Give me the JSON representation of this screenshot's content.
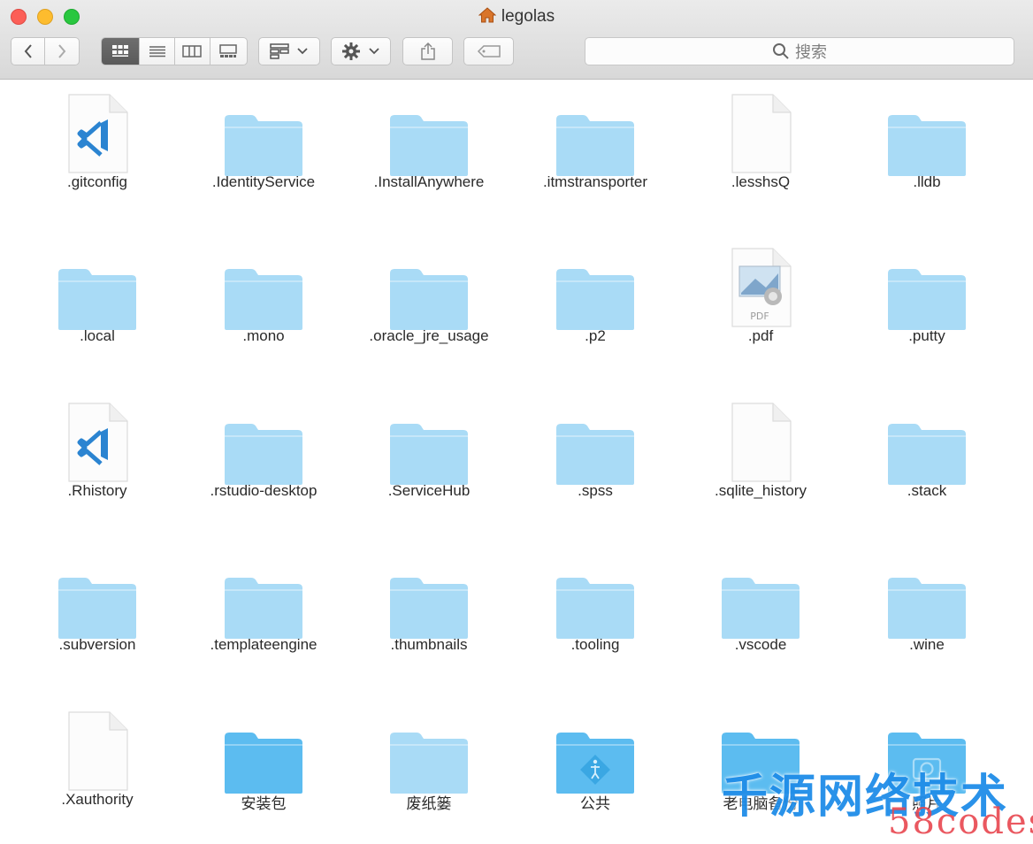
{
  "window": {
    "title": "legolas",
    "title_icon": "home-icon"
  },
  "toolbar": {
    "back": "chevron-left-icon",
    "forward": "chevron-right-icon",
    "views": [
      "icon-view-icon",
      "list-view-icon",
      "column-view-icon",
      "gallery-view-icon"
    ],
    "active_view": 0,
    "arrange": "group-icon",
    "action": "gear-icon",
    "share": "share-icon",
    "tags": "tag-icon"
  },
  "search": {
    "placeholder": "搜索",
    "icon": "search-icon"
  },
  "colors": {
    "folder": "#a9dbf6",
    "folder_dark": "#5cbcf0",
    "vscode": "#2b84d1"
  },
  "items": [
    {
      "label": ".gitconfig",
      "icon": "vscode-doc"
    },
    {
      "label": ".IdentityService",
      "icon": "folder"
    },
    {
      "label": ".InstallAnywhere",
      "icon": "folder"
    },
    {
      "label": ".itmstransporter",
      "icon": "folder"
    },
    {
      "label": ".lesshsQ",
      "icon": "doc"
    },
    {
      "label": ".lldb",
      "icon": "folder"
    },
    {
      "label": ".local",
      "icon": "folder"
    },
    {
      "label": ".mono",
      "icon": "folder"
    },
    {
      "label": ".oracle_jre_usage",
      "icon": "folder"
    },
    {
      "label": ".p2",
      "icon": "folder"
    },
    {
      "label": ".pdf",
      "icon": "pdf-doc"
    },
    {
      "label": ".putty",
      "icon": "folder"
    },
    {
      "label": ".Rhistory",
      "icon": "vscode-doc"
    },
    {
      "label": ".rstudio-desktop",
      "icon": "folder"
    },
    {
      "label": ".ServiceHub",
      "icon": "folder"
    },
    {
      "label": ".spss",
      "icon": "folder"
    },
    {
      "label": ".sqlite_history",
      "icon": "doc"
    },
    {
      "label": ".stack",
      "icon": "folder"
    },
    {
      "label": ".subversion",
      "icon": "folder"
    },
    {
      "label": ".templateengine",
      "icon": "folder"
    },
    {
      "label": ".thumbnails",
      "icon": "folder"
    },
    {
      "label": ".tooling",
      "icon": "folder"
    },
    {
      "label": ".vscode",
      "icon": "folder"
    },
    {
      "label": ".wine",
      "icon": "folder"
    },
    {
      "label": ".Xauthority",
      "icon": "doc"
    },
    {
      "label": "安装包",
      "icon": "folder-dark"
    },
    {
      "label": "废纸篓",
      "icon": "folder"
    },
    {
      "label": "公共",
      "icon": "folder-public"
    },
    {
      "label": "老电脑备份",
      "icon": "folder-dark"
    },
    {
      "label": "照片",
      "icon": "folder-camera"
    }
  ],
  "watermark": {
    "line1": "千源网络技术",
    "line2": "58codes"
  }
}
